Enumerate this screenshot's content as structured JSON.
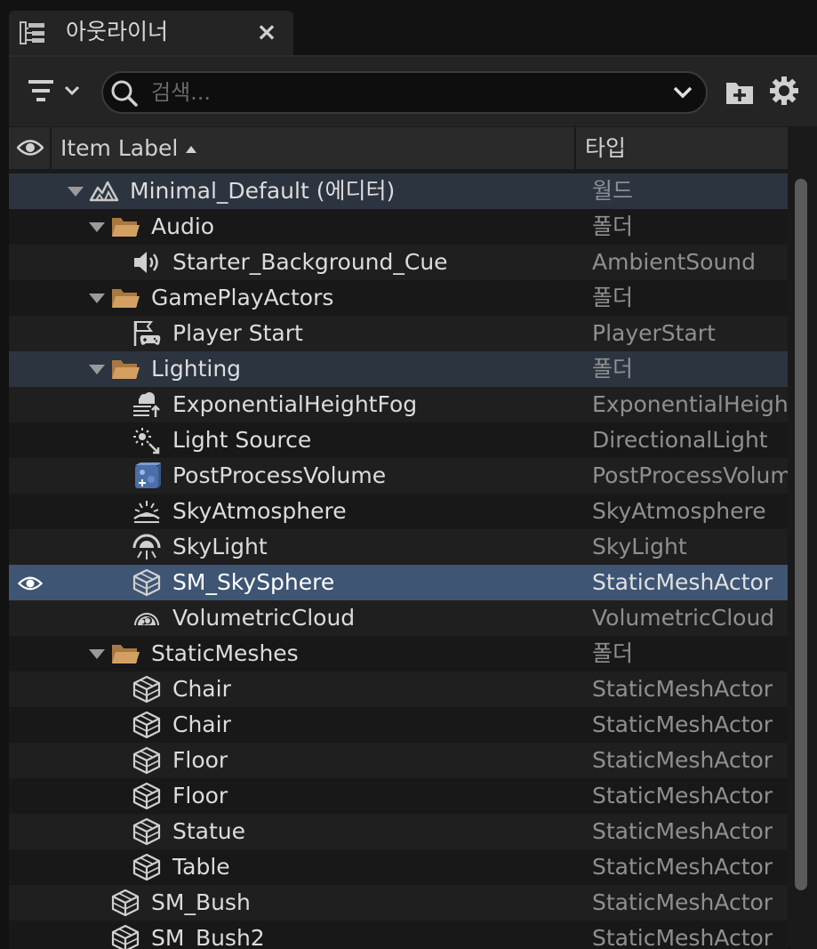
{
  "tab": {
    "title": "아웃라이너",
    "close_glyph": "×"
  },
  "toolbar": {
    "filter_icon": "filter-icon",
    "search_placeholder": "검색...",
    "add_folder_icon": "add-folder-icon",
    "settings_icon": "gear-icon"
  },
  "header": {
    "label_col": "Item Label",
    "type_col": "타입"
  },
  "rows": [
    {
      "label": "Minimal_Default (에디터)",
      "type": "월드",
      "icon": "world-icon",
      "depth": 0,
      "expanded": true,
      "highlight": "hl"
    },
    {
      "label": "Audio",
      "type": "폴더",
      "icon": "folder-icon",
      "depth": 1,
      "expanded": true
    },
    {
      "label": "Starter_Background_Cue",
      "type": "AmbientSound",
      "icon": "speaker-icon",
      "depth": 2
    },
    {
      "label": "GamePlayActors",
      "type": "폴더",
      "icon": "folder-icon",
      "depth": 1,
      "expanded": true
    },
    {
      "label": "Player Start",
      "type": "PlayerStart",
      "icon": "player-start-icon",
      "depth": 2
    },
    {
      "label": "Lighting",
      "type": "폴더",
      "icon": "folder-icon",
      "depth": 1,
      "expanded": true,
      "highlight": "hl"
    },
    {
      "label": "ExponentialHeightFog",
      "type": "ExponentialHeightFog",
      "icon": "fog-icon",
      "depth": 2
    },
    {
      "label": "Light Source",
      "type": "DirectionalLight",
      "icon": "directional-light-icon",
      "depth": 2
    },
    {
      "label": "PostProcessVolume",
      "type": "PostProcessVolume",
      "icon": "post-process-icon",
      "depth": 2
    },
    {
      "label": "SkyAtmosphere",
      "type": "SkyAtmosphere",
      "icon": "sky-atmosphere-icon",
      "depth": 2
    },
    {
      "label": "SkyLight",
      "type": "SkyLight",
      "icon": "sky-light-icon",
      "depth": 2
    },
    {
      "label": "SM_SkySphere",
      "type": "StaticMeshActor",
      "icon": "static-mesh-icon",
      "depth": 2,
      "highlight": "sel",
      "visible_eye": true
    },
    {
      "label": "VolumetricCloud",
      "type": "VolumetricCloud",
      "icon": "cloud-icon",
      "depth": 2
    },
    {
      "label": "StaticMeshes",
      "type": "폴더",
      "icon": "folder-icon",
      "depth": 1,
      "expanded": true
    },
    {
      "label": "Chair",
      "type": "StaticMeshActor",
      "icon": "static-mesh-icon",
      "depth": 2
    },
    {
      "label": "Chair",
      "type": "StaticMeshActor",
      "icon": "static-mesh-icon",
      "depth": 2
    },
    {
      "label": "Floor",
      "type": "StaticMeshActor",
      "icon": "static-mesh-icon",
      "depth": 2
    },
    {
      "label": "Floor",
      "type": "StaticMeshActor",
      "icon": "static-mesh-icon",
      "depth": 2
    },
    {
      "label": "Statue",
      "type": "StaticMeshActor",
      "icon": "static-mesh-icon",
      "depth": 2
    },
    {
      "label": "Table",
      "type": "StaticMeshActor",
      "icon": "static-mesh-icon",
      "depth": 2
    },
    {
      "label": "SM_Bush",
      "type": "StaticMeshActor",
      "icon": "static-mesh-icon",
      "depth": 1
    },
    {
      "label": "SM_Bush2",
      "type": "StaticMeshActor",
      "icon": "static-mesh-icon",
      "depth": 1
    }
  ],
  "colors": {
    "panel_bg": "#1a1a1a",
    "row_selected": "#3e5573",
    "row_highlight": "#2c3440",
    "folder": "#c8965a",
    "text": "#dcdcdc",
    "type_text": "#8f8f8f"
  }
}
